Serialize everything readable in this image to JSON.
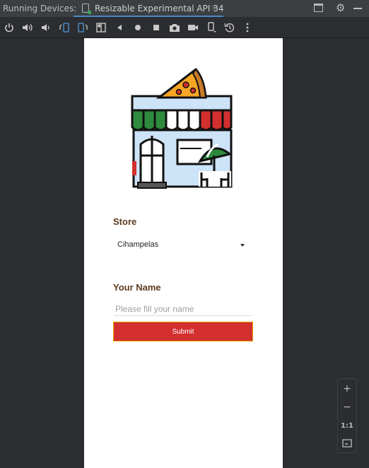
{
  "topbar": {
    "title": "Running Devices:",
    "tab_label": "Resizable Experimental API 34",
    "tab_close": "×"
  },
  "toolbar": {
    "icons": [
      "power-icon",
      "volume-up-icon",
      "volume-down-icon",
      "rotate-left-icon",
      "rotate-right-icon",
      "fold-icon",
      "back-icon",
      "home-icon",
      "overview-icon",
      "screenshot-icon",
      "screen-record-icon",
      "device-frame-icon",
      "restore-snapshot-icon",
      "more-options-icon"
    ]
  },
  "app": {
    "store_label": "Store",
    "store_value": "Cihampelas",
    "name_label": "Your Name",
    "name_placeholder": "Please fill your name",
    "name_value": "",
    "submit_label": "Submit"
  },
  "zoom": {
    "zoom_in": "+",
    "zoom_out": "−",
    "actual_size": "1:1"
  },
  "colors": {
    "accent": "#4a88c7",
    "submit_bg": "#d32f2f",
    "submit_border": "#e8a400",
    "label_color": "#5c3a1e"
  }
}
